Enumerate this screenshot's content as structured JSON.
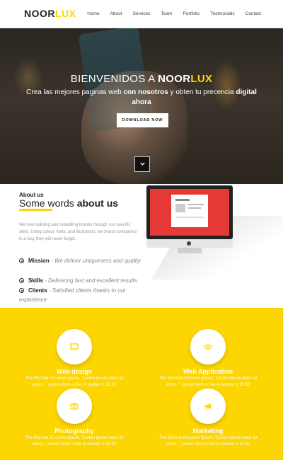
{
  "logo": {
    "main": "NOOR",
    "accent": "LUX"
  },
  "nav": [
    "Home",
    "About",
    "Services",
    "Team",
    "Portfolio",
    "Testmonials",
    "Contact"
  ],
  "hero": {
    "welcome": "BIENVENIDOS A ",
    "brand_main": "NOOR",
    "brand_accent": "LUX",
    "sub_1": "Crea las mejores paginas web ",
    "sub_bold_1": "con nosotros",
    "sub_2": " y obten tu precencia ",
    "sub_bold_2": "digital ahora",
    "download_label": "DOWNLOAD NOW",
    "down_arrow_icon": "chevron-down-icon"
  },
  "about": {
    "label": "About us",
    "title_light": "Some words ",
    "title_bold": "about us",
    "text": "We love building and rebuilding brands through our specific skills. Using colour, fonts, and illustration, we brand companies in a way they will never forget.",
    "features": [
      {
        "name": "Mission",
        "desc": " - We deliver uniqueness and quality"
      },
      {
        "name": "Skills",
        "desc": " - Delivering fast and excellent results"
      },
      {
        "name": "Clients",
        "desc": " - Satisfied clients thanks to our experience"
      }
    ]
  },
  "services": [
    {
      "title": "Web design",
      "icon": "monitor-icon",
      "desc": "The first line of Lorem Ipsum, \"Lorem ipsum dolor sit amet..\", comes from a line in section 1.10.32"
    },
    {
      "title": "Web Application",
      "icon": "eye-icon",
      "desc": "The first line of Lorem Ipsum, \"Lorem ipsum dolor sit amet..\", comes from a line in section 1.10.32"
    },
    {
      "title": "Photography",
      "icon": "camera-icon",
      "desc": "The first line of Lorem Ipsum, \"Lorem ipsum dolor sit amet..\", comes from a line in section 1.10.32"
    },
    {
      "title": "Marketing",
      "icon": "megaphone-icon",
      "desc": "The first line of Lorem Ipsum, \"Lorem ipsum dolor sit amet..\", comes from a line in section 1.10.32"
    }
  ],
  "colors": {
    "accent": "#fdd500",
    "dark": "#222222",
    "screen_red": "#e53935"
  }
}
